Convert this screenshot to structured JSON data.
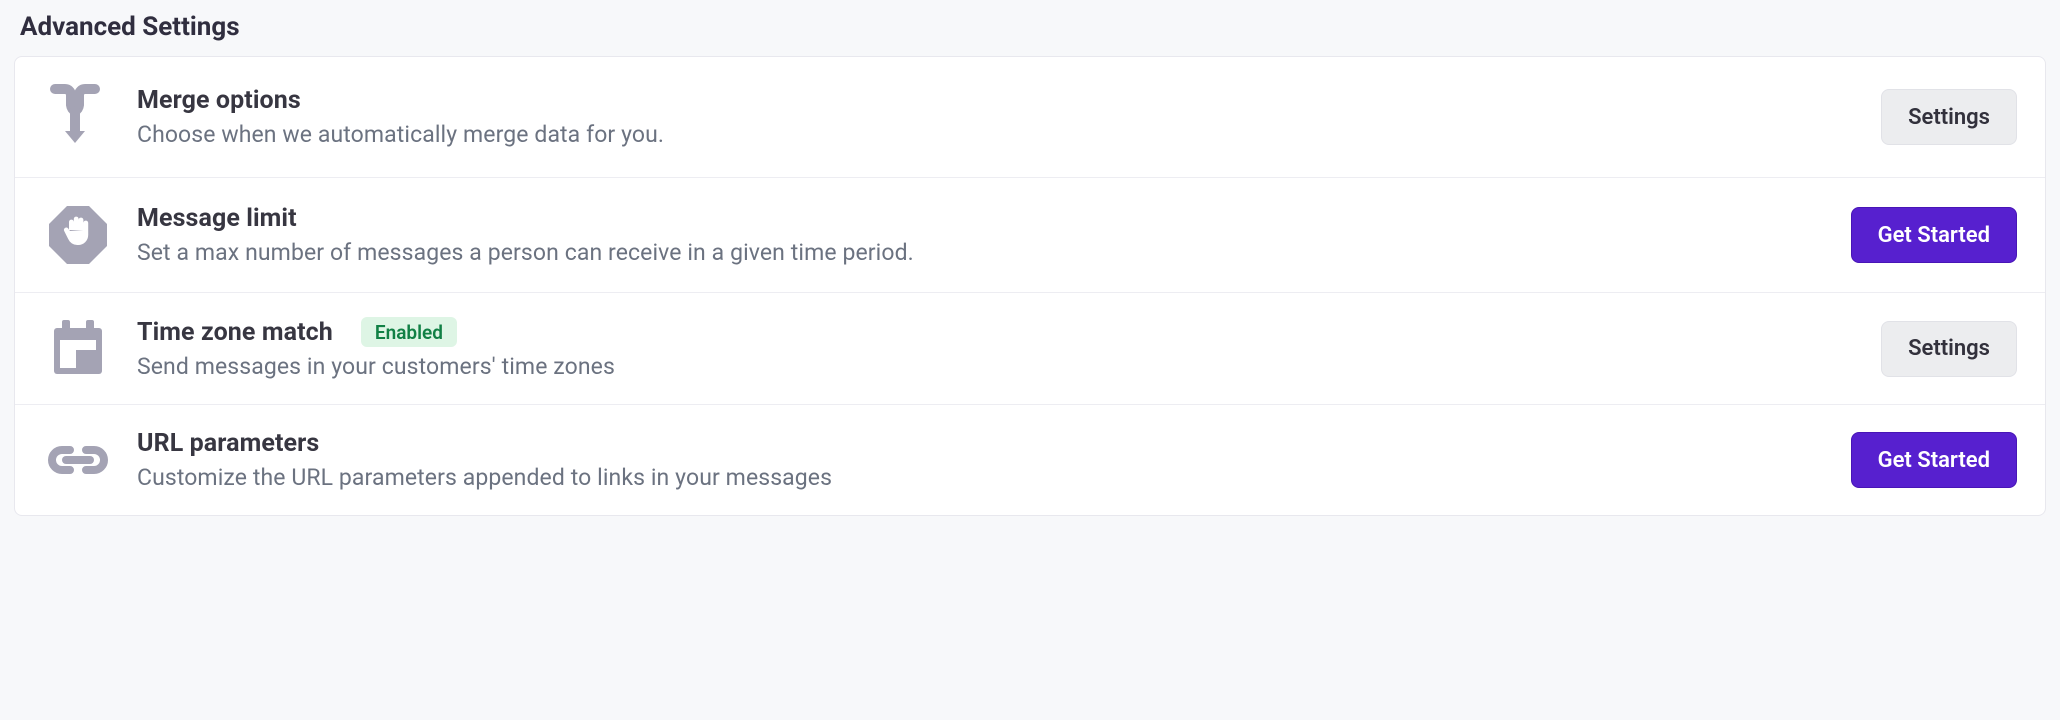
{
  "section_title": "Advanced Settings",
  "buttons": {
    "settings": "Settings",
    "get_started": "Get Started"
  },
  "badges": {
    "enabled": "Enabled"
  },
  "items": [
    {
      "title": "Merge options",
      "desc": "Choose when we automatically merge data for you.",
      "button": "settings",
      "icon": "merge",
      "badge": null
    },
    {
      "title": "Message limit",
      "desc": "Set a max number of messages a person can receive in a given time period.",
      "button": "get_started",
      "icon": "hand-stop",
      "badge": null
    },
    {
      "title": "Time zone match",
      "desc": "Send messages in your customers' time zones",
      "button": "settings",
      "icon": "calendar",
      "badge": "enabled"
    },
    {
      "title": "URL parameters",
      "desc": "Customize the URL parameters appended to links in your messages",
      "button": "get_started",
      "icon": "link",
      "badge": null
    }
  ]
}
